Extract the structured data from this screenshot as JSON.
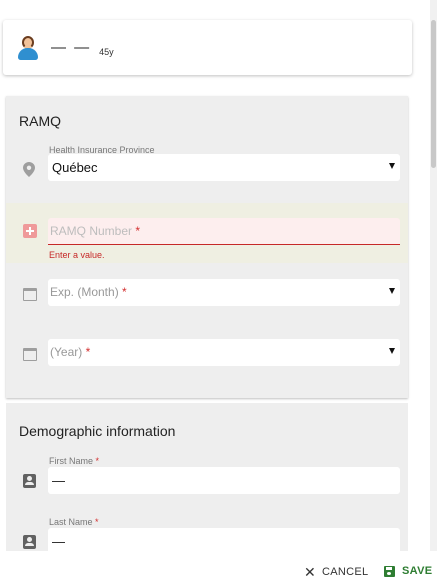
{
  "patient": {
    "name": "— —",
    "age": "45y"
  },
  "ramq": {
    "title": "RAMQ",
    "province": {
      "label": "Health Insurance Province",
      "value": "Québec"
    },
    "number": {
      "placeholder": "RAMQ Number",
      "required_mark": "*",
      "error": "Enter a value."
    },
    "exp_month": {
      "placeholder": "Exp. (Month)",
      "required_mark": "*"
    },
    "exp_year": {
      "placeholder": "(Year)",
      "required_mark": "*"
    }
  },
  "demographic": {
    "title": "Demographic information",
    "first_name": {
      "label": "First Name",
      "required_mark": "*",
      "value": "—"
    },
    "last_name": {
      "label": "Last Name",
      "required_mark": "*",
      "value": "—"
    }
  },
  "footer": {
    "cancel_label": "CANCEL",
    "save_label": "SAVE"
  },
  "colors": {
    "accent": "#2e7d32",
    "error": "#c62828",
    "section_bg": "#eeeeee"
  },
  "icons": [
    "avatar-icon",
    "location-pin-icon",
    "plus-square-icon",
    "calendar-icon",
    "person-card-icon",
    "close-icon",
    "save-disk-icon"
  ]
}
